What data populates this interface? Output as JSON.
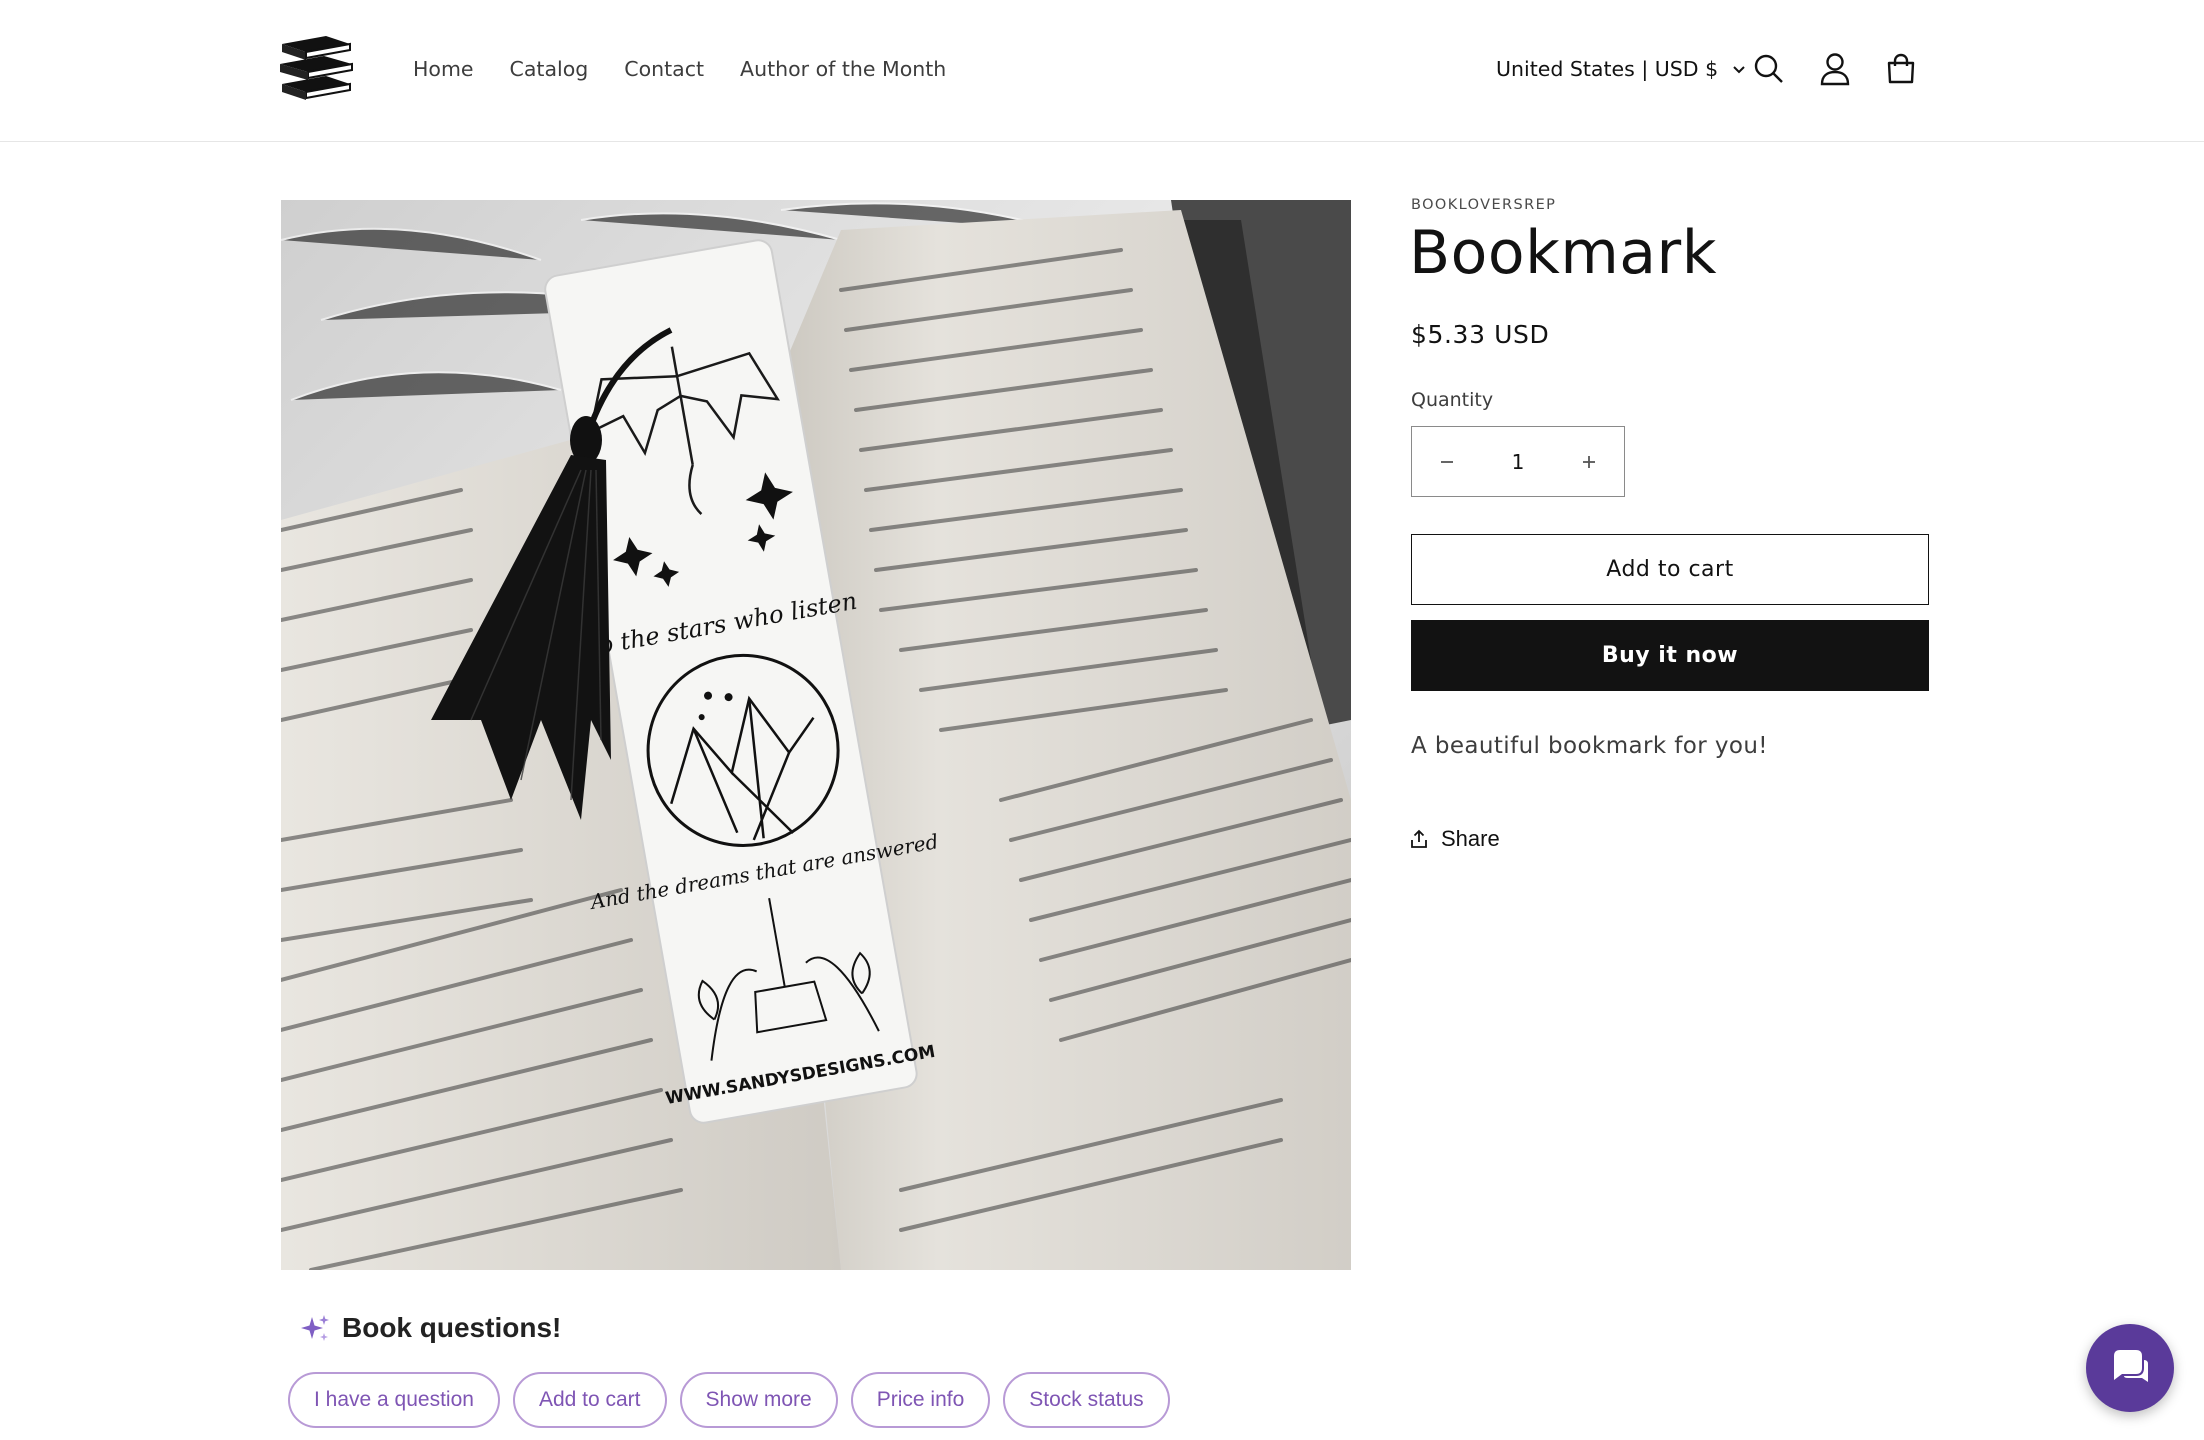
{
  "header": {
    "nav": [
      "Home",
      "Catalog",
      "Contact",
      "Author of the Month"
    ],
    "country": "United States | USD $"
  },
  "product": {
    "vendor": "BOOKLOVERSREP",
    "title": "Bookmark",
    "price": "$5.33 USD",
    "quantity_label": "Quantity",
    "quantity_value": "1",
    "add_to_cart": "Add to cart",
    "buy_now": "Buy it now",
    "description": "A beautiful bookmark for you!",
    "share": "Share"
  },
  "image": {
    "bookmark_text_top": "To the stars who listen",
    "bookmark_text_bottom": "And the dreams that are answered",
    "bookmark_url": "WWW.SANDYSDESIGNS.COM"
  },
  "widget": {
    "title": "Book questions!",
    "chips": [
      "I have a question",
      "Add to cart",
      "Show more",
      "Price info",
      "Stock status"
    ]
  },
  "colors": {
    "accent": "#121212",
    "chip_border": "#b89ad6",
    "chip_text": "#7f55b4",
    "chat_bubble": "#5a3a9a"
  }
}
